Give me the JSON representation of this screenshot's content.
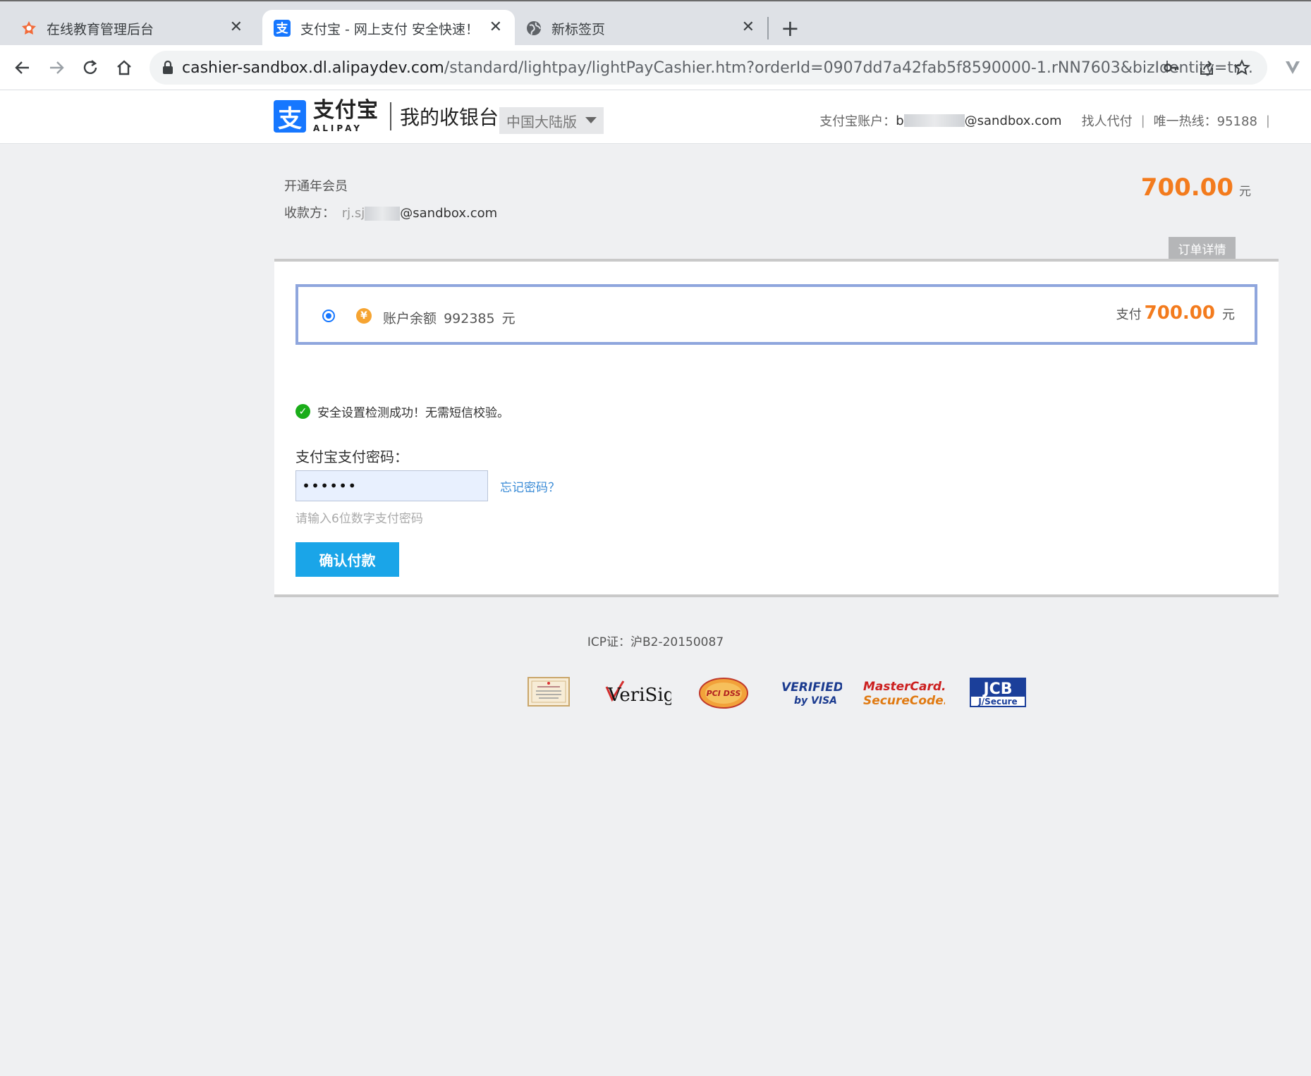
{
  "browser": {
    "tabs": [
      {
        "title": "在线教育管理后台",
        "icon": "flower-icon",
        "active": false
      },
      {
        "title": "支付宝 - 网上支付 安全快速！",
        "icon": "alipay-icon",
        "active": true
      },
      {
        "title": "新标签页",
        "icon": "globe-icon",
        "active": false
      }
    ],
    "close_glyph": "✕",
    "newtab_glyph": "+",
    "url_host": "cashier-sandbox.dl.alipaydev.com",
    "url_path": "/standard/lightpay/lightPayCashier.htm?orderId=0907dd7a42fab5f8590000-1.rNN7603&bizIdentity=tr..."
  },
  "header": {
    "logo_glyph": "支",
    "logo_cn": "支付宝",
    "logo_en": "ALIPAY",
    "title": "我的收银台",
    "region": "中国大陆版",
    "account_label": "支付宝账户：",
    "account_prefix": "b",
    "account_suffix": "@sandbox.com",
    "find_payer": "找人代付",
    "hotline": "唯一热线：95188",
    "pipe": "|"
  },
  "order": {
    "name": "开通年会员",
    "payee_label": "收款方：",
    "payee_prefix": "rj.sj",
    "payee_suffix": "@sandbox.com",
    "amount": "700.00",
    "currency": "元",
    "details_label": "订单详情"
  },
  "payment": {
    "coin_glyph": "¥",
    "balance_label": "账户余额",
    "balance_value": "992385",
    "balance_unit": "元",
    "pay_label": "支付",
    "pay_amount": "700.00",
    "pay_unit": "元",
    "security_msg": "安全设置检测成功！无需短信校验。",
    "check_glyph": "✓",
    "password_label": "支付宝支付密码：",
    "password_value": "••••••",
    "forgot_link": "忘记密码？",
    "password_hint": "请输入6位数字支付密码",
    "confirm_button": "确认付款"
  },
  "footer": {
    "icp": "ICP证：沪B2-20150087",
    "badges": {
      "verisign": "VeriSign",
      "pcidss": "PCI DSS",
      "visa_line1": "VERIFIED",
      "visa_line2": "by VISA",
      "mastercard_line1": "MasterCard.",
      "mastercard_line2": "SecureCode.",
      "jcb_line1": "JCB",
      "jcb_line2": "J/Secure"
    }
  },
  "colors": {
    "accent_orange": "#f37b1d",
    "alipay_blue": "#1677ff",
    "button_blue": "#1aa5e8",
    "success_green": "#1aad19",
    "selection_border": "#8fa6dd"
  }
}
